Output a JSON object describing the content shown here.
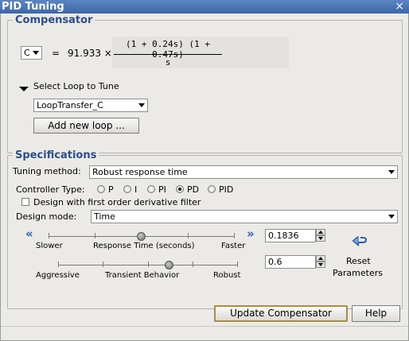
{
  "window": {
    "title": "PID Tuning",
    "close_glyph": "×"
  },
  "compensator": {
    "group_label": "Compensator",
    "name_select": "C",
    "equals": "=",
    "gain": "91.933 ×",
    "numerator": "(1 + 0.24s) (1 + 0.47s)",
    "denominator": "s",
    "loop_toggle_label": "Select Loop to Tune",
    "loop_select": "LoopTransfer_C",
    "add_loop_button": "Add new loop ..."
  },
  "specifications": {
    "group_label": "Specifications",
    "tuning_method_label": "Tuning method:",
    "tuning_method_value": "Robust response time",
    "controller_type_label": "Controller Type:",
    "controller_types": [
      "P",
      "I",
      "PI",
      "PD",
      "PID"
    ],
    "controller_type_selected": "PD",
    "derivative_filter_label": "Design with first order derivative filter",
    "derivative_filter_checked": false,
    "design_mode_label": "Design mode:",
    "design_mode_value": "Time",
    "response_slider": {
      "left_label": "Slower",
      "center_label": "Response Time (seconds)",
      "right_label": "Faster",
      "value": "0.1836",
      "position_fraction": 0.5
    },
    "transient_slider": {
      "left_label": "Aggressive",
      "center_label": "Transient Behavior",
      "right_label": "Robust",
      "value": "0.6",
      "position_fraction": 0.6
    },
    "reset_label_line1": "Reset",
    "reset_label_line2": "Parameters",
    "slower_arrow": "«",
    "faster_arrow": "»"
  },
  "footer": {
    "update_button": "Update Compensator",
    "help_button": "Help"
  },
  "colors": {
    "title_bar": "#3c66a8",
    "group_label": "#2b4e8c",
    "arrow_blue": "#2d5ea8"
  }
}
